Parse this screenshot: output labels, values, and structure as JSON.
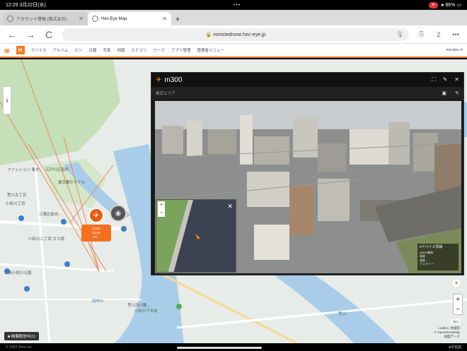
{
  "status_bar": {
    "time": "12:29 3月22日(水)",
    "dots": "•••",
    "recording": "",
    "battery": "● 86% ▭"
  },
  "tabs": [
    {
      "title": "アカウント情報 (株式会社)",
      "active": false
    },
    {
      "title": "Hec-Eye Map",
      "active": true
    }
  ],
  "new_tab": "+",
  "address": {
    "url": "🔒 ministedrone.hec-eye.jp",
    "back": "←",
    "forward": "→",
    "reload": "C",
    "share": "⎘",
    "tabs_count": "2",
    "more": "•••"
  },
  "menubar": {
    "logo": "H",
    "items": [
      "デバイス",
      "アルバム",
      "ピン",
      "日報",
      "写真",
      "地図",
      "カテゴリ",
      "ワーク",
      "アプリ管理",
      "管理者メニュー"
    ],
    "user": "minatec ▾"
  },
  "map": {
    "labels": [
      {
        "text": "ファッション 東大..",
        "color": "normal"
      },
      {
        "text": "江戸川区役所",
        "color": "normal"
      },
      {
        "text": "東京都庁ホテル",
        "color": "normal"
      },
      {
        "text": "荒川五丁目",
        "color": "normal"
      },
      {
        "text": "小松川丁目",
        "color": "normal"
      },
      {
        "text": "小松川二丁目 ガス局",
        "color": "normal"
      },
      {
        "text": "江東区総合..",
        "color": "normal"
      },
      {
        "text": "大島小松川公園",
        "color": "normal"
      },
      {
        "text": "旧中川",
        "color": "blue"
      },
      {
        "text": "荒川",
        "color": "blue"
      },
      {
        "text": "荒川河川敷 ...",
        "color": "normal"
      },
      {
        "text": "小松川千本桜",
        "color": "green"
      }
    ],
    "drone_tag": {
      "line1": "m300",
      "line2": "00:00",
      "line3": "1/5 .."
    },
    "scale": "1km",
    "attribution": [
      "Leaflet | 地理院",
      "© OpenStreetMap",
      "地図データ"
    ],
    "bottom_button": "■ 映像配信中(1)",
    "zoom_in": "+",
    "zoom_out": "−"
  },
  "video_window": {
    "title": "m300",
    "subtitle": "東京エリア",
    "header_controls": [
      "⛶",
      "✎",
      "✕"
    ],
    "sub_controls": [
      "▣",
      "✎"
    ],
    "pip_zoom": [
      "+",
      "−"
    ],
    "pip_close": "✕",
    "info_title": "▾デバイス情報",
    "info_lines": [
      "m300 機体",
      "高度 ..",
      "速度 ..",
      "バッテリー .."
    ]
  },
  "bottom_bar": {
    "left": "© 2023 Terra Inc.",
    "right": "●日本語"
  },
  "colors": {
    "accent": "#f47a20",
    "river": "#a9cde9",
    "park": "#c5dfb8"
  }
}
